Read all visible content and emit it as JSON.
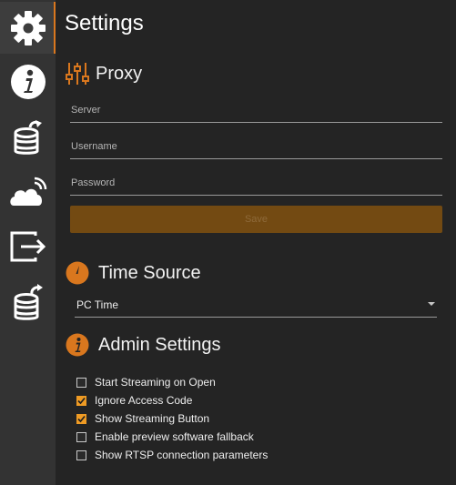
{
  "sidebar": {
    "items": [
      {
        "name": "gear-icon",
        "active": true
      },
      {
        "name": "info-icon",
        "active": false
      },
      {
        "name": "database-import-icon",
        "active": false
      },
      {
        "name": "cloud-signal-icon",
        "active": false
      },
      {
        "name": "exit-icon",
        "active": false
      },
      {
        "name": "database-export-icon",
        "active": false
      }
    ]
  },
  "header": {
    "title": "Settings"
  },
  "proxy": {
    "title": "Proxy",
    "icon": "sliders-icon",
    "server_placeholder": "Server",
    "username_placeholder": "Username",
    "password_placeholder": "Password",
    "save_label": "Save"
  },
  "time_source": {
    "title": "Time Source",
    "icon": "clock-icon",
    "selected": "PC Time"
  },
  "admin": {
    "title": "Admin Settings",
    "icon": "info-icon",
    "options": [
      {
        "label": "Start Streaming on Open",
        "checked": false
      },
      {
        "label": "Ignore Access Code",
        "checked": true
      },
      {
        "label": "Show Streaming Button",
        "checked": true
      },
      {
        "label": "Enable preview software fallback",
        "checked": false
      },
      {
        "label": "Show RTSP connection parameters",
        "checked": false
      }
    ]
  },
  "colors": {
    "accent": "#ef9b24",
    "button": "#734a12",
    "sidebar": "#333333",
    "background": "#242424"
  }
}
